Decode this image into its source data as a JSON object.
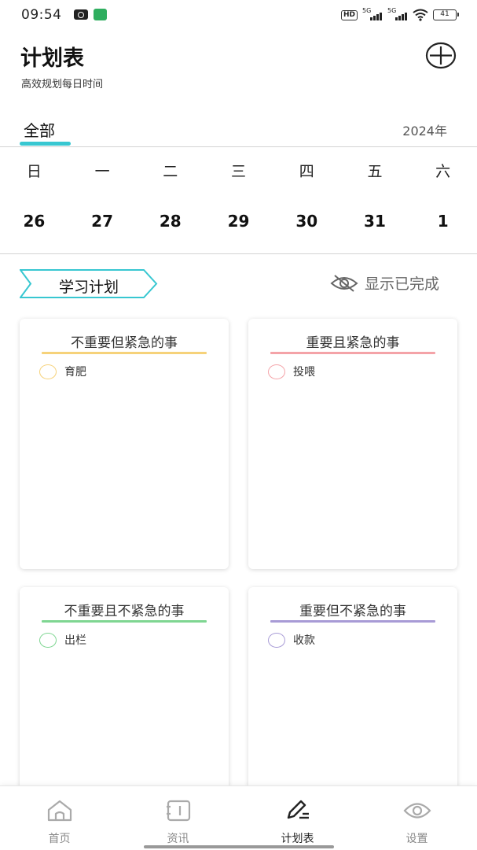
{
  "status_bar": {
    "time": "09:54",
    "network": "5G",
    "battery": "41"
  },
  "header": {
    "title": "计划表",
    "subtitle": "高效规划每日时间",
    "add_icon": "plus-circle-icon"
  },
  "tabs": {
    "active": "全部",
    "year": "2024年"
  },
  "calendar": {
    "weekdays": [
      "日",
      "一",
      "二",
      "三",
      "四",
      "五",
      "六"
    ],
    "dates": [
      "26",
      "27",
      "28",
      "29",
      "30",
      "31",
      "1"
    ]
  },
  "plan": {
    "tag": "学习计划",
    "show_done": "显示已完成",
    "show_done_icon": "eye-off-icon"
  },
  "quadrants": [
    {
      "title": "不重要但紧急的事",
      "color": "#f6d27a",
      "task": "育肥"
    },
    {
      "title": "重要且紧急的事",
      "color": "#f4a3a8",
      "task": "投喂"
    },
    {
      "title": "不重要且不紧急的事",
      "color": "#7fd692",
      "task": "出栏"
    },
    {
      "title": "重要但不紧急的事",
      "color": "#a89bd6",
      "task": "收款"
    }
  ],
  "nav": [
    {
      "label": "首页",
      "icon": "home-icon"
    },
    {
      "label": "资讯",
      "icon": "news-icon"
    },
    {
      "label": "计划表",
      "icon": "edit-plan-icon",
      "active": true
    },
    {
      "label": "设置",
      "icon": "settings-icon"
    }
  ],
  "accent_color": "#38c7d1"
}
